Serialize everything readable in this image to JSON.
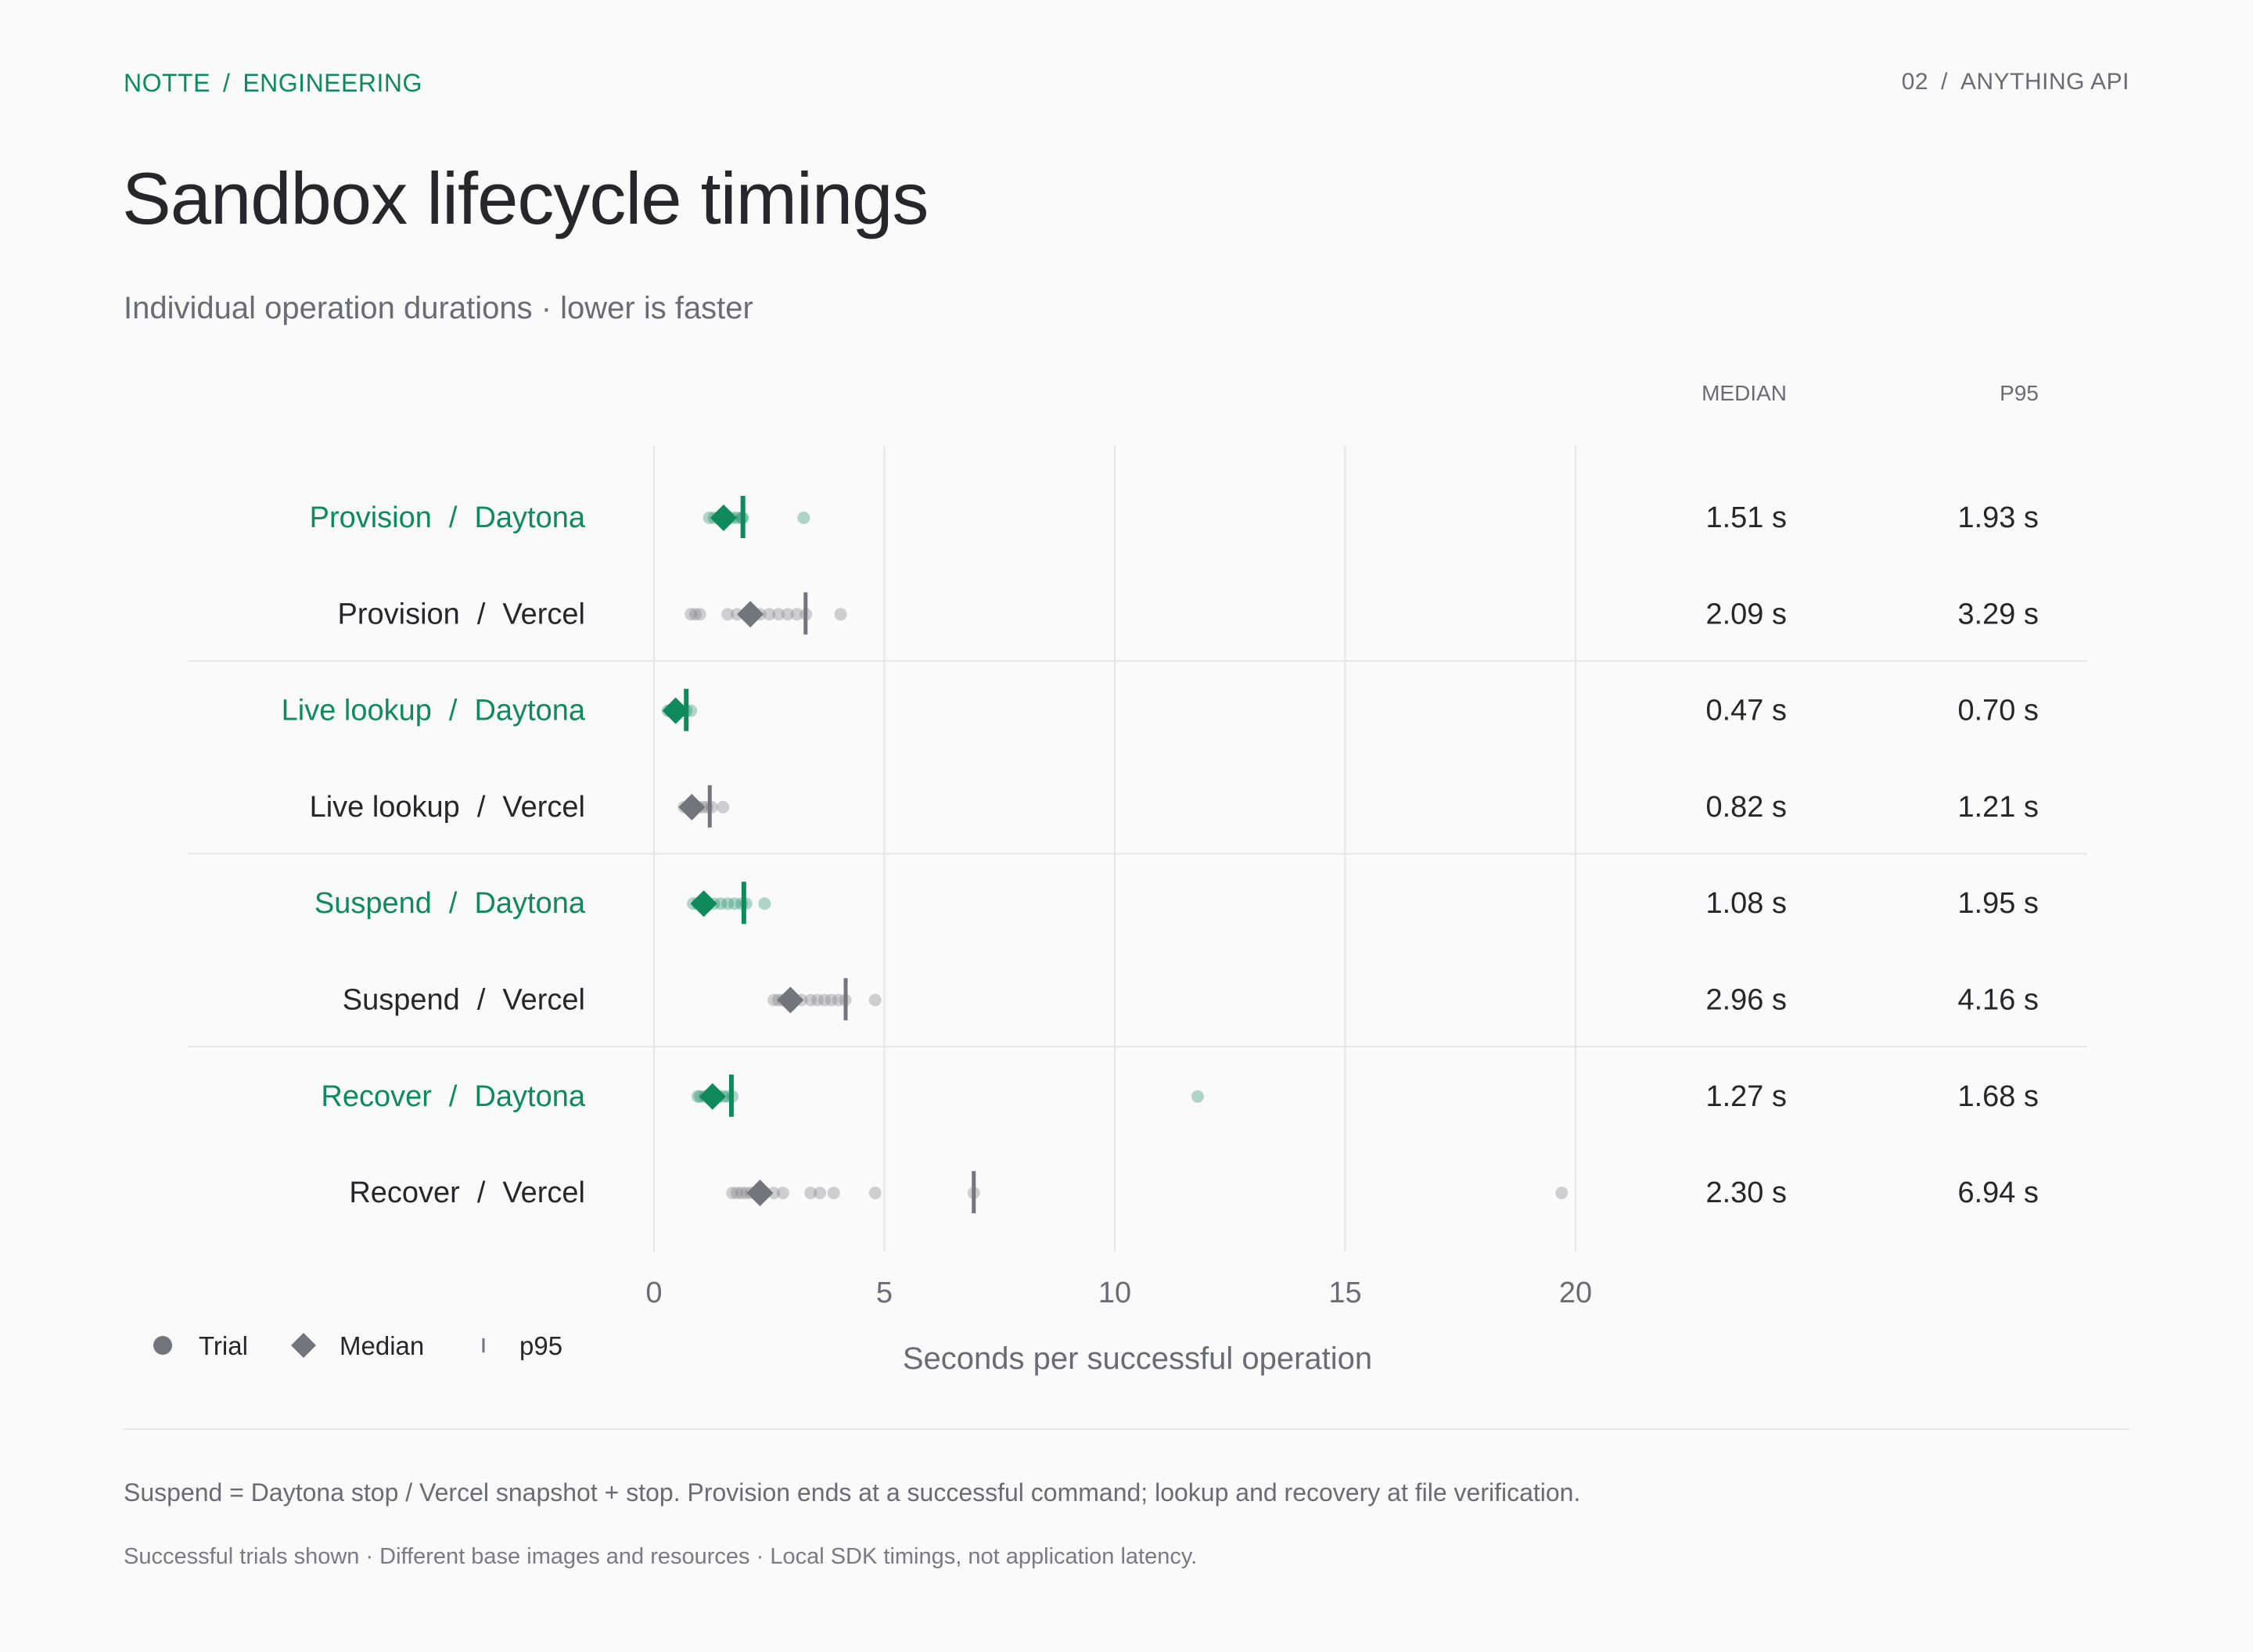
{
  "header": {
    "breadcrumb": [
      "NOTTE",
      "ENGINEERING"
    ],
    "page_ref": [
      "02",
      "ANYTHING API"
    ],
    "title": "Sandbox lifecycle timings",
    "subtitle": "Individual operation durations · lower is faster"
  },
  "colors": {
    "daytona": "#0e8a5c",
    "vercel": "#74747c",
    "text": "#26262b",
    "muted": "#6b6b73",
    "grid": "#e6e6e6"
  },
  "chart_data": {
    "type": "scatter",
    "xlabel": "Seconds per successful operation",
    "xlim": [
      0,
      22
    ],
    "xticks": [
      0,
      5,
      10,
      15,
      20
    ],
    "grid": true,
    "columns": [
      "MEDIAN",
      "P95"
    ],
    "separator": "/",
    "legend": [
      "Trial",
      "Median",
      "p95"
    ],
    "legend_position": "bottom-left",
    "rows": [
      {
        "operation": "Provision",
        "provider": "Daytona",
        "median": 1.51,
        "p95": 1.93,
        "median_label": "1.51 s",
        "p95_label": "1.93 s",
        "trials": [
          1.2,
          1.3,
          1.4,
          1.45,
          1.5,
          1.55,
          1.6,
          1.7,
          1.8,
          1.9,
          1.93,
          3.25
        ]
      },
      {
        "operation": "Provision",
        "provider": "Vercel",
        "median": 2.09,
        "p95": 3.29,
        "median_label": "2.09 s",
        "p95_label": "3.29 s",
        "trials": [
          0.8,
          0.9,
          1.0,
          1.6,
          1.8,
          2.0,
          2.1,
          2.3,
          2.5,
          2.7,
          2.9,
          3.1,
          3.3,
          4.05
        ]
      },
      {
        "operation": "Live lookup",
        "provider": "Daytona",
        "median": 0.47,
        "p95": 0.7,
        "median_label": "0.47 s",
        "p95_label": "0.70 s",
        "trials": [
          0.3,
          0.35,
          0.4,
          0.45,
          0.5,
          0.55,
          0.6,
          0.7,
          0.8
        ]
      },
      {
        "operation": "Live lookup",
        "provider": "Vercel",
        "median": 0.82,
        "p95": 1.21,
        "median_label": "0.82 s",
        "p95_label": "1.21 s",
        "trials": [
          0.65,
          0.75,
          0.85,
          0.95,
          1.05,
          1.15,
          1.25,
          1.5
        ]
      },
      {
        "operation": "Suspend",
        "provider": "Daytona",
        "median": 1.08,
        "p95": 1.95,
        "median_label": "1.08 s",
        "p95_label": "1.95 s",
        "trials": [
          0.85,
          0.95,
          1.05,
          1.15,
          1.3,
          1.45,
          1.6,
          1.75,
          1.9,
          2.0,
          2.4
        ]
      },
      {
        "operation": "Suspend",
        "provider": "Vercel",
        "median": 2.96,
        "p95": 4.16,
        "median_label": "2.96 s",
        "p95_label": "4.16 s",
        "trials": [
          2.6,
          2.7,
          2.8,
          3.0,
          3.2,
          3.4,
          3.55,
          3.7,
          3.85,
          4.0,
          4.15,
          4.8
        ]
      },
      {
        "operation": "Recover",
        "provider": "Daytona",
        "median": 1.27,
        "p95": 1.68,
        "median_label": "1.27 s",
        "p95_label": "1.68 s",
        "trials": [
          0.95,
          1.0,
          1.1,
          1.2,
          1.3,
          1.4,
          1.5,
          1.6,
          1.7,
          11.8
        ]
      },
      {
        "operation": "Recover",
        "provider": "Vercel",
        "median": 2.3,
        "p95": 6.94,
        "median_label": "2.30 s",
        "p95_label": "6.94 s",
        "trials": [
          1.7,
          1.8,
          1.9,
          2.0,
          2.1,
          2.2,
          2.4,
          2.6,
          2.8,
          3.4,
          3.6,
          3.9,
          4.8,
          6.94,
          19.7
        ]
      }
    ]
  },
  "footnotes": {
    "line1": "Suspend = Daytona stop / Vercel snapshot + stop. Provision ends at a successful command; lookup and recovery at file verification.",
    "line2": "Successful trials shown · Different base images and resources · Local SDK timings, not application latency."
  }
}
